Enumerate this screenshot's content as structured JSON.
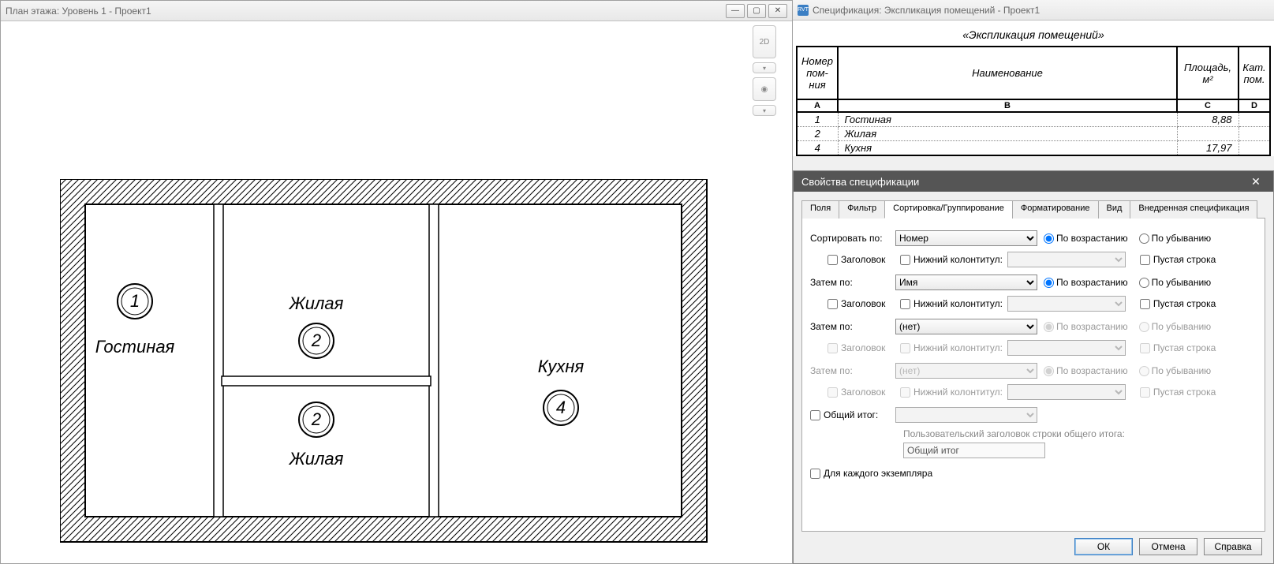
{
  "left_window": {
    "title": "План этажа: Уровень 1 - Проект1",
    "rooms": [
      {
        "num": "1",
        "name": "Гостиная"
      },
      {
        "num": "2",
        "name": "Жилая"
      },
      {
        "num": "2",
        "name": "Жилая"
      },
      {
        "num": "4",
        "name": "Кухня"
      }
    ],
    "nav_cube_label": "2D"
  },
  "schedule_window": {
    "title": "Спецификация: Экспликация помещений - Проект1",
    "rvt_icon_text": "RVT",
    "table_title": "«Экспликация помещений»",
    "headers": [
      "Номер пом-ния",
      "Наименование",
      "Площадь, м²",
      "Кат. пом."
    ],
    "col_letters": [
      "A",
      "B",
      "C",
      "D"
    ],
    "rows": [
      {
        "num": "1",
        "name": "Гостиная",
        "area": "8,88",
        "cat": ""
      },
      {
        "num": "2",
        "name": "Жилая",
        "area": "",
        "cat": ""
      },
      {
        "num": "4",
        "name": "Кухня",
        "area": "17,97",
        "cat": ""
      }
    ]
  },
  "dialog": {
    "title": "Свойства спецификации",
    "tabs": [
      "Поля",
      "Фильтр",
      "Сортировка/Группирование",
      "Форматирование",
      "Вид",
      "Внедренная спецификация"
    ],
    "active_tab": 2,
    "sort1": {
      "label": "Сортировать по:",
      "value": "Номер",
      "asc_label": "По возрастанию",
      "desc_label": "По убыванию",
      "asc": true,
      "header_label": "Заголовок",
      "footer_label": "Нижний колонтитул:",
      "blank_label": "Пустая строка"
    },
    "sort2": {
      "label": "Затем по:",
      "value": "Имя",
      "asc_label": "По возрастанию",
      "desc_label": "По убыванию",
      "asc": true,
      "header_label": "Заголовок",
      "footer_label": "Нижний колонтитул:",
      "blank_label": "Пустая строка"
    },
    "sort3": {
      "label": "Затем по:",
      "value": "(нет)",
      "asc_label": "По возрастанию",
      "desc_label": "По убыванию",
      "header_label": "Заголовок",
      "footer_label": "Нижний колонтитул:",
      "blank_label": "Пустая строка"
    },
    "sort4": {
      "label": "Затем по:",
      "value": "(нет)",
      "asc_label": "По возрастанию",
      "desc_label": "По убыванию",
      "header_label": "Заголовок",
      "footer_label": "Нижний колонтитул:",
      "blank_label": "Пустая строка"
    },
    "grand_total_label": "Общий итог:",
    "grand_total_hint": "Пользовательский заголовок строки общего итога:",
    "grand_total_value": "Общий итог",
    "per_instance_label": "Для каждого экземпляра",
    "ok": "ОК",
    "cancel": "Отмена",
    "help": "Справка"
  }
}
